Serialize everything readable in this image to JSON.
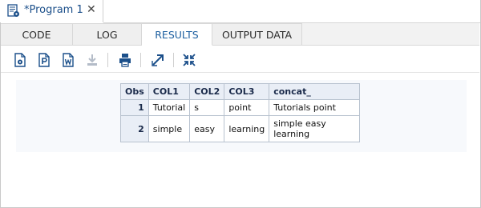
{
  "program_tab": {
    "title": "*Program 1",
    "close": "✕",
    "icon": "program-file-icon"
  },
  "subtabs": [
    {
      "label": "CODE",
      "active": false
    },
    {
      "label": "LOG",
      "active": false
    },
    {
      "label": "RESULTS",
      "active": true
    },
    {
      "label": "OUTPUT DATA",
      "active": false
    }
  ],
  "toolbar": {
    "icons": [
      "download-html-icon",
      "download-pdf-icon",
      "download-word-icon",
      "save-icon-disabled",
      "print-icon",
      "open-new-window-icon",
      "collapse-icon"
    ]
  },
  "table": {
    "headers": [
      "Obs",
      "COL1",
      "COL2",
      "COL3",
      "concat_"
    ],
    "rows": [
      [
        "1",
        "Tutorial",
        "s",
        "point",
        "Tutorials point"
      ],
      [
        "2",
        "simple",
        "easy",
        "learning",
        "simple easy learning"
      ]
    ]
  },
  "colors": {
    "accent": "#1d5fa0",
    "icon": "#1b4f8a"
  }
}
